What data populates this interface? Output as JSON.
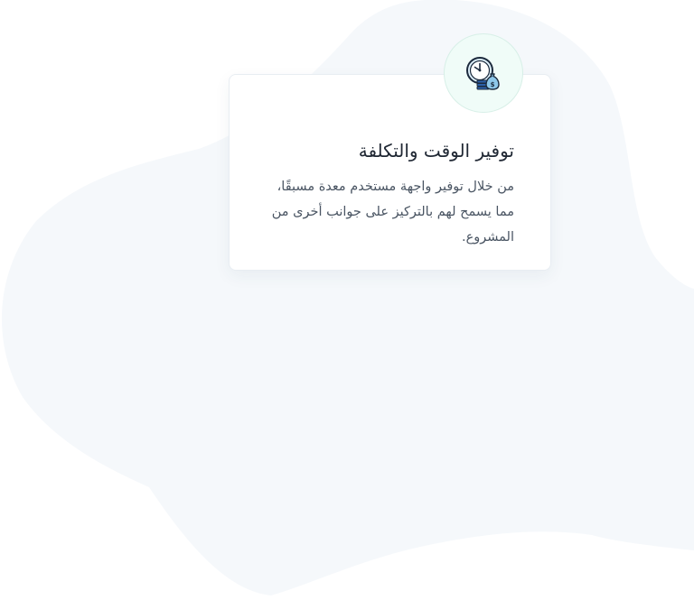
{
  "feature_card": {
    "icon": "time-money-icon",
    "title": "توفير الوقت والتكلفة",
    "description": "من خلال توفير واجهة مستخدم معدة مسبقًا، مما يسمح لهم بالتركيز على جوانب أخرى من المشروع."
  },
  "colors": {
    "background_blob": "#f5f8fb",
    "icon_circle_bg": "#f0fcf8",
    "title_text": "#1f2733",
    "body_text": "#4a5563"
  }
}
